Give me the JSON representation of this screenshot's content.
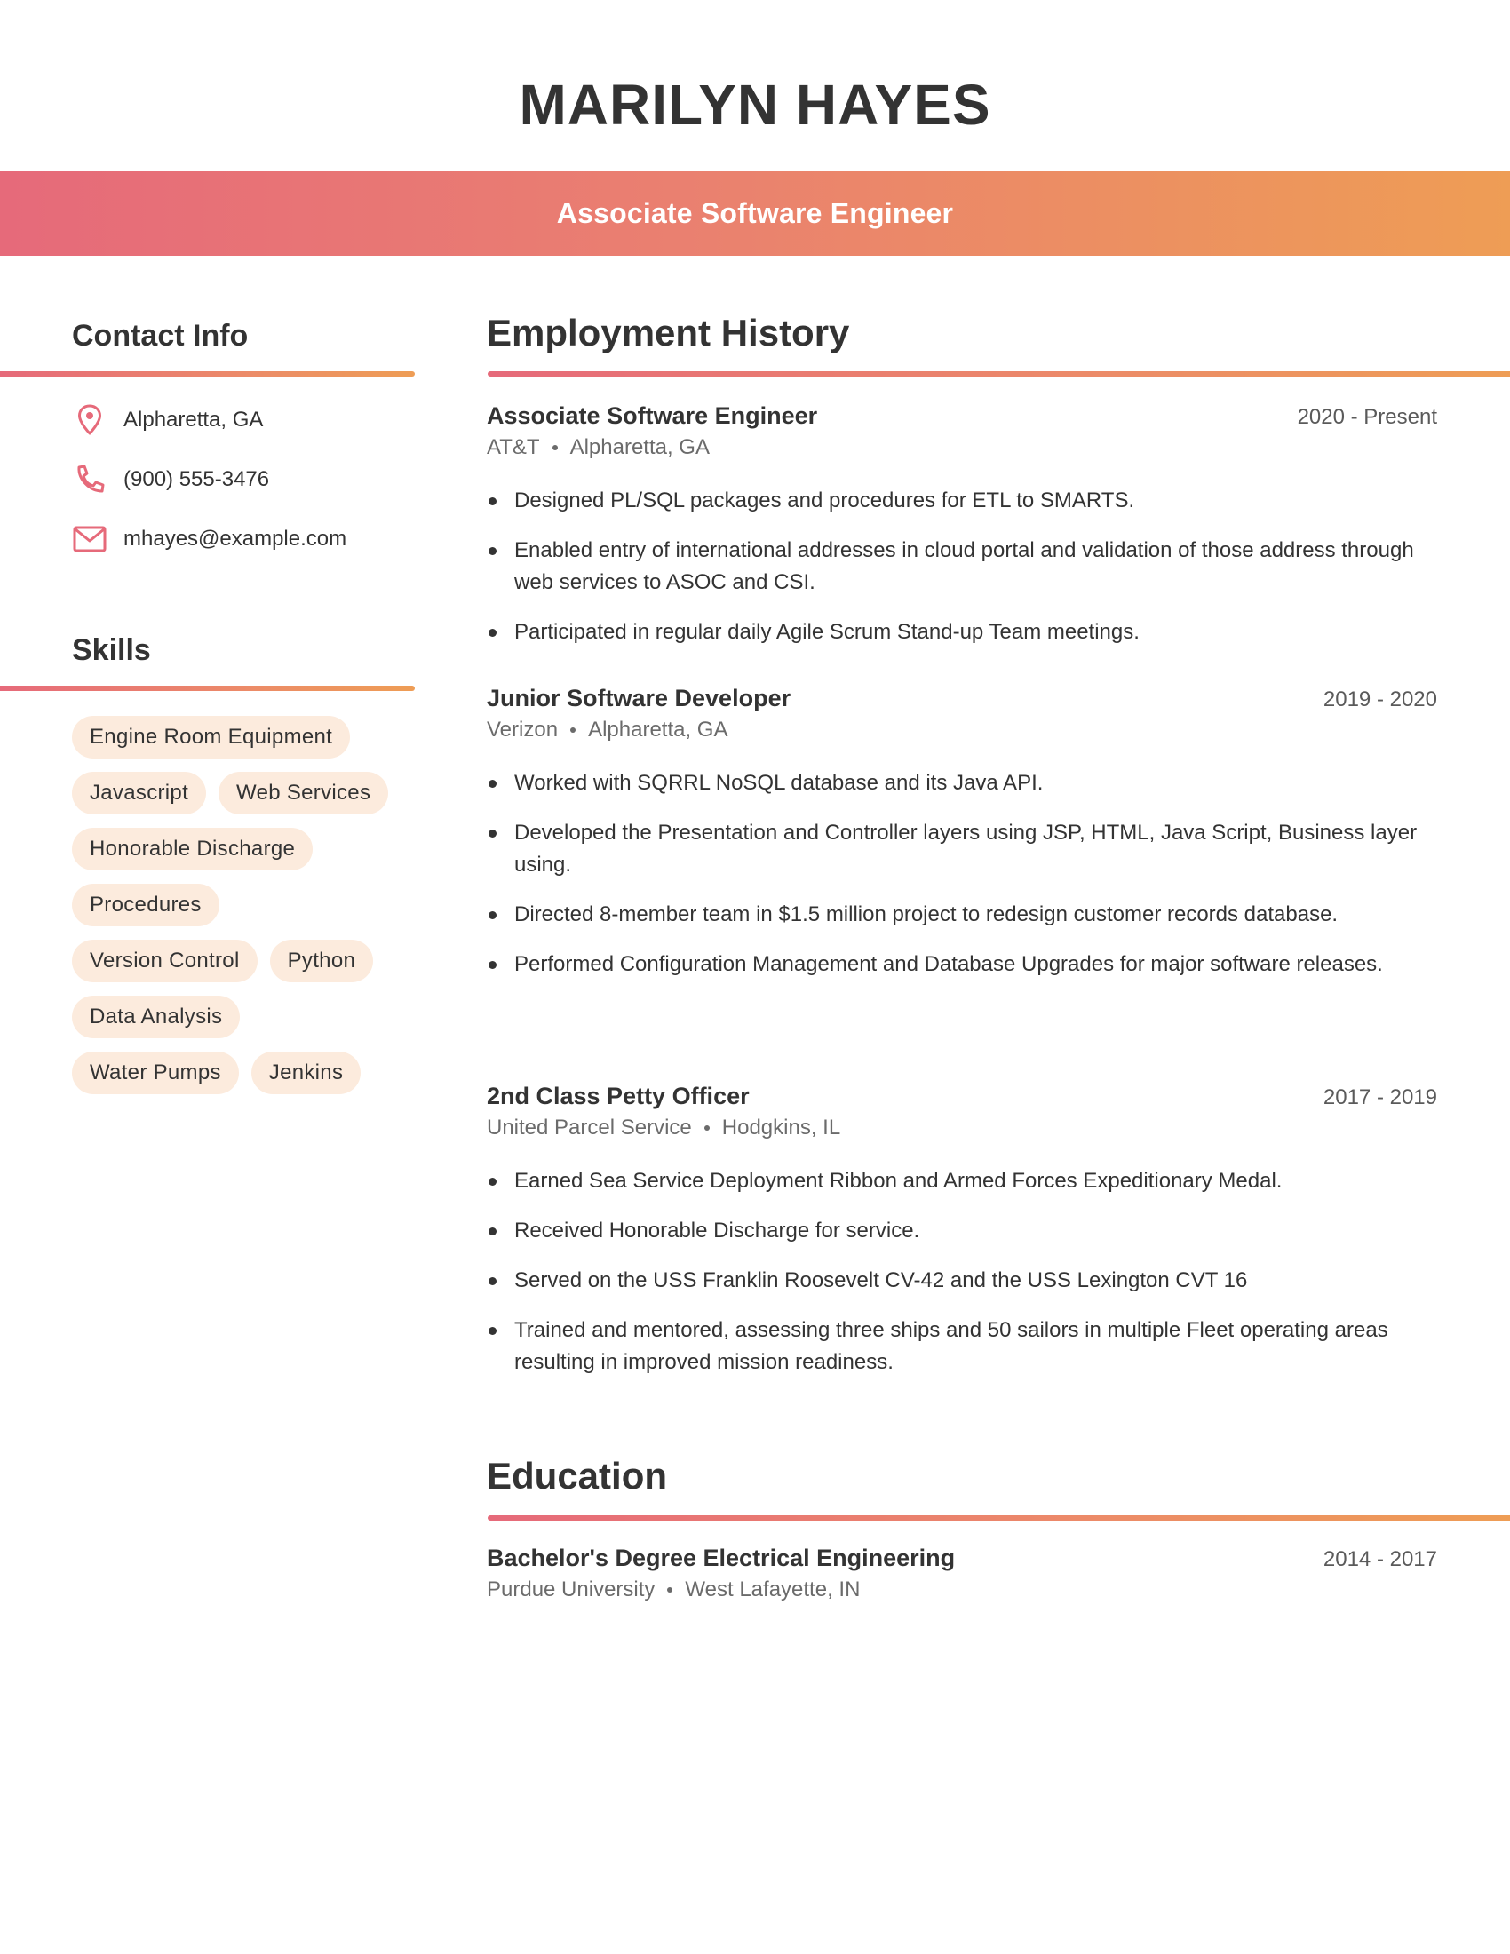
{
  "header": {
    "name": "MARILYN HAYES",
    "title": "Associate Software Engineer"
  },
  "colors": {
    "gradient_start": "#E66A7A",
    "gradient_end": "#EE9D55",
    "pill_bg": "#FCEBDD",
    "text": "#333333",
    "icon": "#E66A7A"
  },
  "contact": {
    "heading": "Contact Info",
    "items": [
      {
        "icon": "location-pin-icon",
        "text": "Alpharetta, GA"
      },
      {
        "icon": "phone-icon",
        "text": "(900) 555-3476"
      },
      {
        "icon": "email-icon",
        "text": "mhayes@example.com"
      }
    ]
  },
  "skills": {
    "heading": "Skills",
    "items": [
      "Engine Room Equipment",
      "Javascript",
      "Web Services",
      "Honorable Discharge",
      "Procedures",
      "Version Control",
      "Python",
      "Data Analysis",
      "Water Pumps",
      "Jenkins"
    ]
  },
  "employment": {
    "heading": "Employment History",
    "jobs": [
      {
        "title": "Associate Software Engineer",
        "dates": "2020 - Present",
        "company": "AT&T",
        "location": "Alpharetta, GA",
        "bullets": [
          "Designed PL/SQL packages and procedures for ETL to SMARTS.",
          "Enabled entry of international addresses in cloud portal and validation of those address through web services to ASOC and CSI.",
          "Participated in regular daily Agile Scrum Stand-up Team meetings."
        ]
      },
      {
        "title": "Junior Software Developer",
        "dates": "2019 - 2020",
        "company": "Verizon",
        "location": "Alpharetta, GA",
        "bullets": [
          "Worked with SQRRL NoSQL database and its Java API.",
          "Developed the Presentation and Controller layers using JSP, HTML, Java Script, Business layer using.",
          "Directed 8-member team in $1.5 million project to redesign customer records database.",
          "Performed Configuration Management and Database Upgrades for major software releases."
        ]
      },
      {
        "title": "2nd Class Petty Officer",
        "dates": "2017 - 2019",
        "company": "United Parcel Service",
        "location": "Hodgkins, IL",
        "bullets": [
          "Earned Sea Service Deployment Ribbon and Armed Forces Expeditionary Medal.",
          "Received Honorable Discharge for service.",
          "Served on the USS Franklin Roosevelt CV-42 and the USS Lexington CVT 16",
          "Trained and mentored, assessing three ships and 50 sailors in multiple Fleet operating areas resulting in improved mission readiness."
        ]
      }
    ]
  },
  "education": {
    "heading": "Education",
    "entries": [
      {
        "degree": "Bachelor's Degree Electrical Engineering",
        "dates": "2014 - 2017",
        "school": "Purdue University",
        "location": "West Lafayette, IN"
      }
    ]
  }
}
